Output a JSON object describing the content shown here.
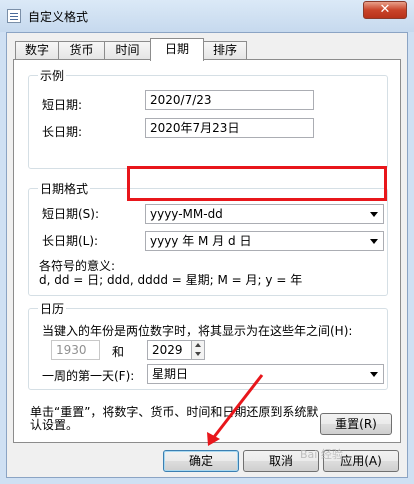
{
  "window": {
    "title": "自定义格式",
    "close_glyph": "✕",
    "icon": "format-icon"
  },
  "tabs": [
    {
      "label": "数字",
      "active": false
    },
    {
      "label": "货币",
      "active": false
    },
    {
      "label": "时间",
      "active": false
    },
    {
      "label": "日期",
      "active": true
    },
    {
      "label": "排序",
      "active": false
    }
  ],
  "example": {
    "title": "示例",
    "short_label": "短日期:",
    "short_value": "2020/7/23",
    "long_label": "长日期:",
    "long_value": "2020年7月23日"
  },
  "date_format": {
    "title": "日期格式",
    "short_label": "短日期(S):",
    "short_value": "yyyy-MM-dd",
    "long_label": "长日期(L):",
    "long_value": "yyyy 年 M 月 d 日",
    "symbols_title": "各符号的意义:",
    "symbols_text": "d, dd = 日;  ddd, dddd = 星期;  M = 月;  y = 年"
  },
  "calendar": {
    "title": "日历",
    "two_digit_text": "当键入的年份是两位数字时，将其显示为在这些年之间(H):",
    "from_year": "1930",
    "and_label": "和",
    "to_year": "2029",
    "first_day_label": "一周的第一天(F):",
    "first_day_value": "星期日"
  },
  "footer": {
    "reset_text": "单击“重置”，将数字、货币、时间和日期还原到系统默认设置。",
    "reset_button": "重置(R)",
    "ok_button": "确定",
    "cancel_button": "取消",
    "apply_button": "应用(A)"
  },
  "colors": {
    "highlight": "#e8161b",
    "annotation_arrow": "#e8161b"
  }
}
